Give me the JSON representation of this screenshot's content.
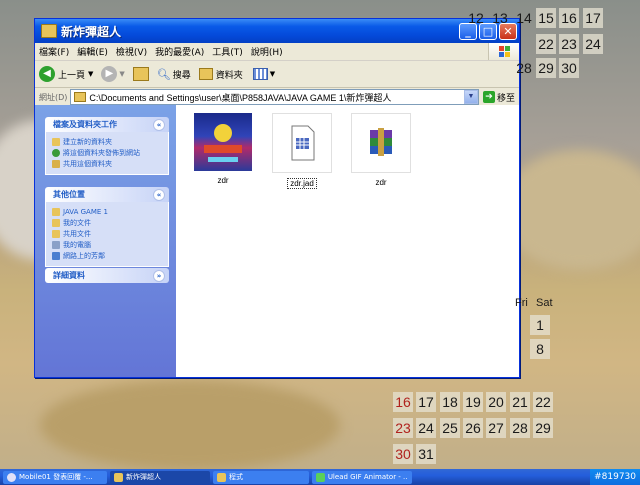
{
  "window": {
    "title": "新炸彈超人",
    "controls": {
      "minimize": "_",
      "maximize": "□",
      "close": "✕"
    }
  },
  "menu": [
    "檔案(F)",
    "編輯(E)",
    "檢視(V)",
    "我的最愛(A)",
    "工具(T)",
    "說明(H)"
  ],
  "toolbar": {
    "back": "上一頁",
    "search": "搜尋",
    "folders": "資料夾"
  },
  "address": {
    "label": "網址(D)",
    "path": "C:\\Documents and Settings\\user\\桌面\\P858JAVA\\JAVA GAME 1\\新炸彈超人",
    "go": "移至"
  },
  "tasks_pane": {
    "title": "檔案及資料夾工作",
    "items": [
      "建立新的資料夾",
      "將這個資料夾發佈到網站",
      "共用這個資料夾"
    ]
  },
  "places_pane": {
    "title": "其他位置",
    "items": [
      "JAVA GAME 1",
      "我的文件",
      "共用文件",
      "我的電腦",
      "網路上的芳鄰"
    ]
  },
  "details_pane": {
    "title": "詳細資料"
  },
  "files": [
    {
      "name": "zdr",
      "icon": "game-thumbnail-icon",
      "selected": false
    },
    {
      "name": "zdr.jad",
      "icon": "jad-file-icon",
      "selected": true
    },
    {
      "name": "zdr",
      "icon": "winrar-archive-icon",
      "selected": false
    }
  ],
  "calendar": {
    "header": [
      "Fri",
      "Sat"
    ],
    "top_row1": [
      "12",
      "13",
      "14",
      "15",
      "16",
      "17"
    ],
    "top_row2": [
      "22",
      "23",
      "24"
    ],
    "top_row3": [
      "28",
      "29",
      "30"
    ],
    "sat_col": [
      "1",
      "8"
    ],
    "bottom_row1": [
      "16",
      "17",
      "18",
      "19",
      "20",
      "21",
      "22"
    ],
    "bottom_row2": [
      "23",
      "24",
      "25",
      "26",
      "27",
      "28",
      "29"
    ],
    "bottom_row3": [
      "30",
      "31"
    ]
  },
  "taskbar": {
    "buttons": [
      "Mobile01 發表回覆 -...",
      "新炸彈超人",
      "程式",
      "Ulead GIF Animator - ..."
    ],
    "tray_text": "#819730"
  }
}
